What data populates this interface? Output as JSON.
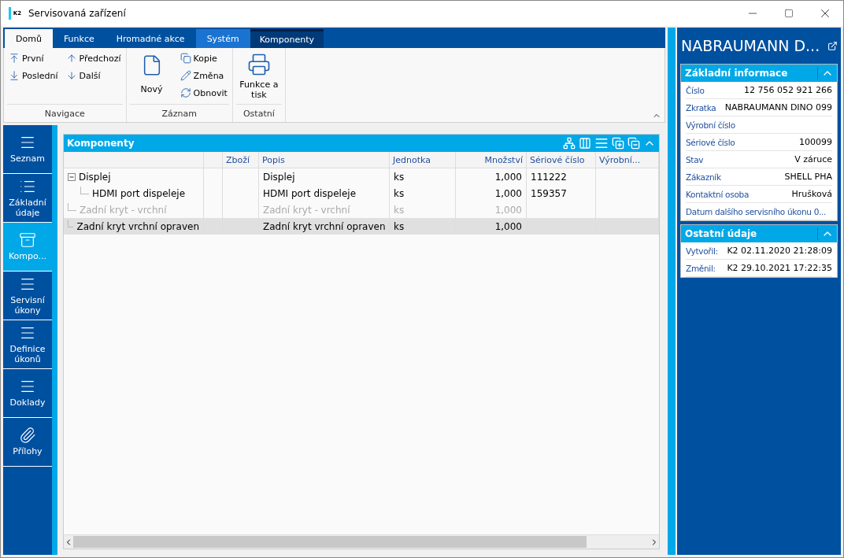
{
  "window": {
    "title": "Servisovaná zařízení",
    "logo": "K2"
  },
  "ribbon": {
    "tabs": [
      {
        "label": "Domů",
        "selected": true,
        "kind": "normal"
      },
      {
        "label": "Funkce",
        "selected": false,
        "kind": "normal"
      },
      {
        "label": "Hromadné akce",
        "selected": false,
        "kind": "normal"
      },
      {
        "label": "Systém",
        "selected": false,
        "kind": "system"
      },
      {
        "label": "Komponenty",
        "selected": false,
        "kind": "context"
      }
    ],
    "groups": [
      {
        "label": "Navigace",
        "kind": "grid",
        "items": [
          {
            "label": "První"
          },
          {
            "label": "Poslední"
          },
          {
            "label": "Předchozí"
          },
          {
            "label": "Další"
          }
        ]
      },
      {
        "label": "Záznam",
        "kind": "mixed",
        "items": [
          {
            "label": "Nový"
          },
          {
            "label": "Kopie"
          },
          {
            "label": "Změna"
          },
          {
            "label": "Obnovit"
          }
        ]
      },
      {
        "label": "Ostatní",
        "kind": "large",
        "items": [
          {
            "label": "Funkce a tisk"
          }
        ]
      }
    ]
  },
  "nav": [
    {
      "label": "Seznam",
      "selected": false
    },
    {
      "label": "Základní údaje",
      "selected": false
    },
    {
      "label": "Kompo...",
      "selected": true
    },
    {
      "label": "Servisní úkony",
      "selected": false
    },
    {
      "label": "Definice úkonů",
      "selected": false
    },
    {
      "label": "Doklady",
      "selected": false
    },
    {
      "label": "Přílohy",
      "selected": false
    }
  ],
  "table": {
    "title": "Komponenty",
    "columns": [
      "",
      "",
      "Zboží",
      "Popis",
      "Jednotka",
      "Množství",
      "Sériové číslo",
      "Výrobní..."
    ],
    "rows": [
      {
        "cells": [
          "Displej",
          "",
          "",
          "Displej",
          "ks",
          "1,000",
          "111222",
          ""
        ],
        "expanded": true,
        "disabled": false,
        "selected": false,
        "children": [
          {
            "cells": [
              "HDMI port dispeleje",
              "",
              "",
              "HDMI port dispeleje",
              "ks",
              "1,000",
              "159357",
              ""
            ],
            "disabled": false,
            "selected": false
          }
        ]
      },
      {
        "cells": [
          "Zadní kryt - vrchní",
          "",
          "",
          "Zadní kryt - vrchní",
          "ks",
          "1,000",
          "",
          ""
        ],
        "disabled": true,
        "selected": false
      },
      {
        "cells": [
          "Zadní kryt vrchní opraven",
          "",
          "",
          "Zadní kryt vrchní opraven",
          "ks",
          "1,000",
          "",
          ""
        ],
        "disabled": false,
        "selected": true
      }
    ]
  },
  "detail": {
    "title": "NABRAUMANN D...",
    "sections": [
      {
        "title": "Základní informace",
        "expanded": true,
        "fields": [
          {
            "label": "Číslo",
            "value": "12 756 052 921 266"
          },
          {
            "label": "Zkratka",
            "value": "NABRAUMANN DINO 099"
          },
          {
            "label": "Výrobní číslo"
          },
          {
            "label": "Sériové číslo",
            "value": "100099"
          },
          {
            "label": "Stav",
            "value": "V záruce"
          },
          {
            "label": "Zákazník",
            "value": "SHELL PHA"
          },
          {
            "label": "Kontaktní osoba",
            "value": "Hrušková"
          },
          {
            "label": "Datum dalšího servisního úkonu 0..."
          }
        ]
      },
      {
        "title": "Ostatní údaje",
        "expanded": true,
        "fields": [
          {
            "label": "Vytvořil:",
            "value": "K2 02.11.2020 21:28:09"
          },
          {
            "label": "Změnil:",
            "value": "K2 29.10.2021 17:22:35"
          }
        ]
      }
    ]
  }
}
